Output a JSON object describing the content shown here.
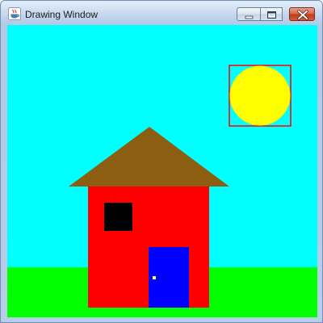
{
  "window": {
    "title": "Drawing Window",
    "controls": {
      "minimize_icon": "minimize-icon",
      "maximize_icon": "maximize-icon",
      "close_icon": "close-icon"
    }
  },
  "scene": {
    "sky_color": "#00ffff",
    "grass_color": "#00ff00",
    "sun_color": "#ffff00",
    "sun_frame_color": "#ff0000",
    "roof_color": "#8c5e12",
    "wall_color": "#ff0000",
    "window_color": "#000000",
    "door_color": "#0000ff",
    "doorknob_color": "#ffff66"
  }
}
